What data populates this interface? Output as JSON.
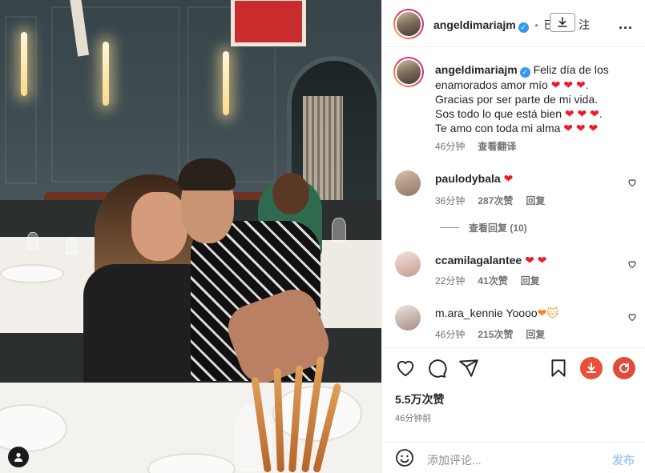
{
  "header": {
    "username": "angeldimariajm",
    "dot": "•",
    "follow_partial": "已",
    "follow_partial2": "注",
    "more": "..."
  },
  "caption": {
    "username": "angeldimariajm",
    "line1": "Feliz día de los",
    "line2": "enamorados amor mío",
    "line3": "Gracias por ser parte de mi vida.",
    "line4": "Sos todo lo que está bien",
    "line5": "Te amo con toda mi alma",
    "time": "46分钟",
    "translate": "查看翻译"
  },
  "comments": [
    {
      "username": "paulodybala",
      "text": "",
      "time": "36分钟",
      "likes": "287次赞",
      "reply": "回复"
    },
    {
      "username": "ccamilagalantee",
      "text": "",
      "time": "22分钟",
      "likes": "41次赞",
      "reply": "回复"
    },
    {
      "username": "m.ara_kennie",
      "text": "Yoooo",
      "time": "46分钟",
      "likes": "215次赞",
      "reply": "回复"
    }
  ],
  "view_replies": "查看回复 (10)",
  "likes_total": "5.5万次赞",
  "posted_ago": "46分钟前",
  "add_comment": {
    "placeholder": "添加评论...",
    "post": "发布"
  },
  "colors": {
    "accent_blue": "#3897f0",
    "heart_red": "#ed1c24",
    "post_disabled": "#a8c9f3"
  },
  "icons": [
    "heart-icon",
    "comment-icon",
    "share-icon",
    "bookmark-icon",
    "download-icon",
    "refresh-icon",
    "emoji-icon",
    "verified-icon",
    "more-icon",
    "person-tag-icon"
  ]
}
